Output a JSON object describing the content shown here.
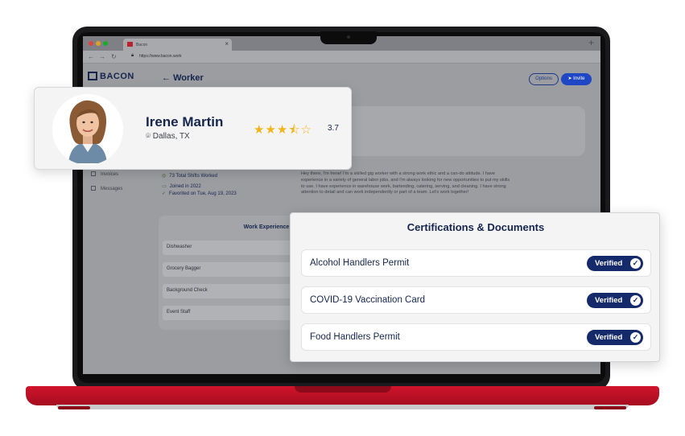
{
  "browser": {
    "tab_title": "Bacon",
    "url": "https://www.bacon.work"
  },
  "app": {
    "logo_text": "BACON",
    "page_title": "Worker",
    "options_label": "Options",
    "invite_label": "Invite",
    "sidebar": {
      "items": [
        {
          "label": "Invoices"
        },
        {
          "label": "Messages"
        }
      ]
    },
    "stats": {
      "total_shifts": "73 Total Shifts Worked",
      "joined": "Joined in 2022",
      "favorited": "Favorited on Tue, Aug 19, 2023"
    },
    "bio": "Hey there, I'm Irene! I'm a skilled gig worker with a strong work ethic and a can-do attitude. I have experience in a variety of general labor jobs, and I'm always looking for new opportunities to put my skills to use. I have experience in warehouse work, bartending, catering, serving, and cleaning. I have strong attention to detail and can work independently or part of a team. Let's work together!",
    "work_experience": {
      "title": "Work Experience",
      "items": [
        {
          "label": "Dishwasher"
        },
        {
          "label": "Grocery Bagger"
        },
        {
          "label": "Background Check"
        },
        {
          "label": "Event Staff"
        }
      ]
    }
  },
  "profile": {
    "name": "Irene Martin",
    "location": "Dallas, TX",
    "rating": "3.7",
    "rating_value": 3.7,
    "stars_display": "★★★⯪☆"
  },
  "certifications": {
    "title": "Certifications & Documents",
    "items": [
      {
        "label": "Alcohol Handlers Permit",
        "status": "Verified"
      },
      {
        "label": "COVID-19 Vaccination Card",
        "status": "Verified"
      },
      {
        "label": "Food Handlers Permit",
        "status": "Verified"
      }
    ]
  },
  "colors": {
    "brand_navy": "#16254d",
    "verified_badge": "#142a6b",
    "laptop_red": "#d0142b",
    "star": "#f2b61c"
  }
}
